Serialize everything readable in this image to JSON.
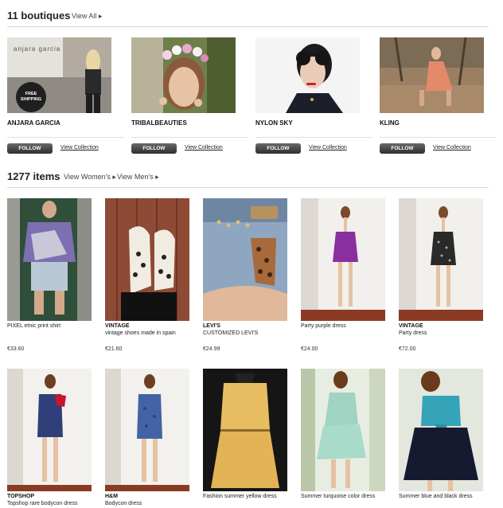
{
  "boutiques_section": {
    "title": "11 boutiques",
    "view_all": "View All ▸"
  },
  "boutiques": [
    {
      "name": "ANJARA GARCIA",
      "logo_text": "anjara garcia",
      "badge": "FREE SHIPPING",
      "follow": "FOLLOW",
      "view": "View Collection"
    },
    {
      "name": "TRIBALBEAUTIES",
      "follow": "FOLLOW",
      "view": "View Collection"
    },
    {
      "name": "NYLON SKY",
      "follow": "FOLLOW",
      "view": "View Collection"
    },
    {
      "name": "KLING",
      "follow": "FOLLOW",
      "view": "View Collection"
    }
  ],
  "items_section": {
    "title": "1277 items",
    "view_womens": "View Women's ▸",
    "view_mens": "View Men's ▸"
  },
  "items": [
    {
      "brand": "",
      "title": "PIXEL etnic print shirt",
      "price": "€33.60"
    },
    {
      "brand": "VINTAGE",
      "title": "vintage shoes made in spain",
      "price": "€21.60"
    },
    {
      "brand": "LEVI'S",
      "title": "CUSTOMIZED LEVI'S",
      "price": "€24.99"
    },
    {
      "brand": "",
      "title": "Party purple dress",
      "price": "€24.00"
    },
    {
      "brand": "VINTAGE",
      "title": "Party dress",
      "price": "€72.00"
    },
    {
      "brand": "TOPSHOP",
      "title": "Topshop rare bodycon dress",
      "price": ""
    },
    {
      "brand": "H&M",
      "title": "Bodycon dress",
      "price": ""
    },
    {
      "brand": "",
      "title": "Fashion summer yellow dress",
      "price": ""
    },
    {
      "brand": "",
      "title": "Summer turquoise color dress",
      "price": ""
    },
    {
      "brand": "",
      "title": "Summer blue and black dress",
      "price": ""
    }
  ]
}
